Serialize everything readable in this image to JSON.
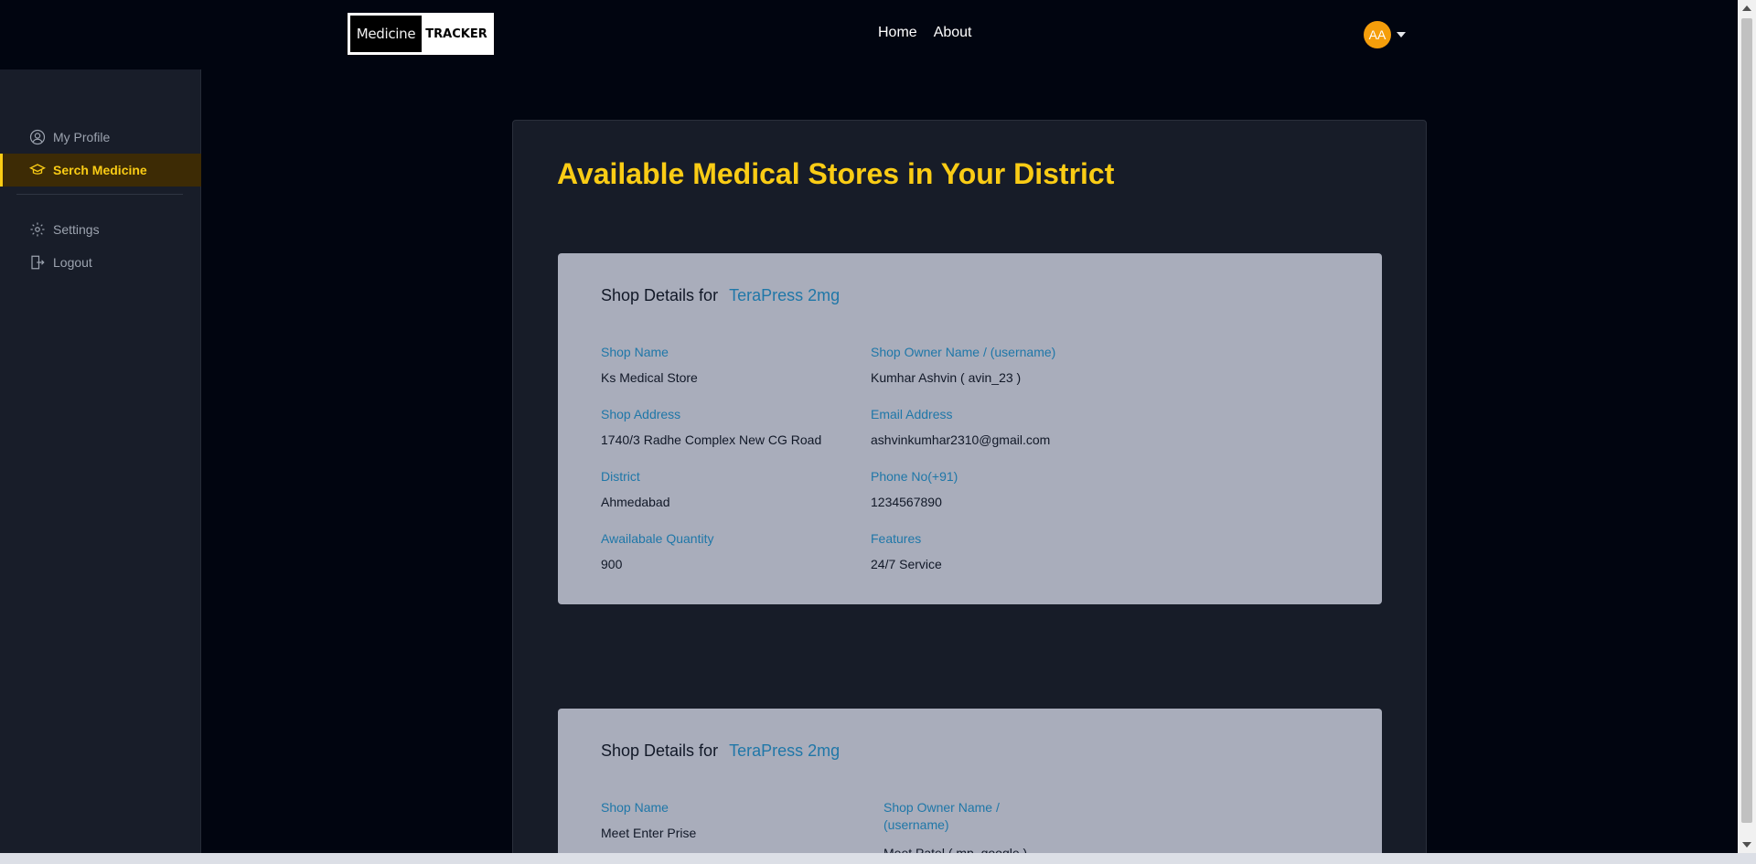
{
  "navbar": {
    "logo_left": "Medicine",
    "logo_right": "TRACKER",
    "links": [
      "Home",
      "About"
    ],
    "avatar_initials": "AA"
  },
  "sidebar": {
    "items": [
      {
        "label": "My Profile",
        "icon": "user-circle-icon"
      },
      {
        "label": "Serch Medicine",
        "icon": "graduation-cap-icon",
        "active": true
      },
      {
        "label": "Settings",
        "icon": "gear-icon"
      },
      {
        "label": "Logout",
        "icon": "logout-icon"
      }
    ]
  },
  "main": {
    "title": "Available Medical Stores in Your District",
    "cards": [
      {
        "heading_prefix": "Shop Details for",
        "medicine": "TeraPress 2mg",
        "shop_name_label": "Shop Name",
        "shop_name": "Ks Medical Store",
        "owner_label": "Shop Owner Name / (username)",
        "owner": "Kumhar Ashvin ( avin_23 )",
        "address_label": "Shop Address",
        "address": "1740/3 Radhe Complex New CG Road",
        "email_label": "Email Address",
        "email": "ashvinkumhar2310@gmail.com",
        "district_label": "District",
        "district": "Ahmedabad",
        "phone_label": "Phone No(+91)",
        "phone": "1234567890",
        "quantity_label": "Awailabale Quantity",
        "quantity": "900",
        "features_label": "Features",
        "features": "24/7 Service"
      },
      {
        "heading_prefix": "Shop Details for",
        "medicine": "TeraPress 2mg",
        "shop_name_label": "Shop Name",
        "shop_name": "Meet Enter Prise",
        "owner_label_line1": "Shop Owner Name /",
        "owner_label_line2": "(username)",
        "owner": "Meet Patel ( mp_google )"
      }
    ]
  },
  "colors": {
    "accent": "#facc15",
    "link": "#1f77a8",
    "card_bg": "#a9adbb",
    "avatar_bg": "#f59e0b"
  }
}
